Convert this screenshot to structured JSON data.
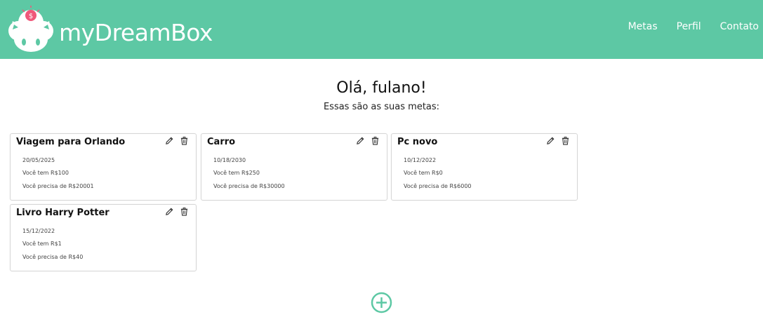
{
  "header": {
    "brand": "myDreamBox",
    "nav": [
      "Metas",
      "Perfil",
      "Contato"
    ]
  },
  "greeting": "Olá, fulano!",
  "subtitle": "Essas são as suas metas:",
  "goals": [
    {
      "title": "Viagem para Orlando",
      "date": "20/05/2025",
      "have": "Você tem R$100",
      "need": "Você precisa de R$20001"
    },
    {
      "title": "Carro",
      "date": "10/18/2030",
      "have": "Você tem R$250",
      "need": "Você precisa de R$30000"
    },
    {
      "title": "Pc novo",
      "date": "10/12/2022",
      "have": "Você tem R$0",
      "need": "Você precisa de R$6000"
    },
    {
      "title": "Livro Harry Potter",
      "date": "15/12/2022",
      "have": "Você tem R$1",
      "need": "Você precisa de R$40"
    }
  ],
  "colors": {
    "accent": "#5dc8a4",
    "coin": "#f0587a"
  },
  "icons": {
    "edit": "pencil-icon",
    "delete": "trash-icon",
    "add": "plus-circle-icon",
    "logo": "piggy-logo-icon"
  }
}
